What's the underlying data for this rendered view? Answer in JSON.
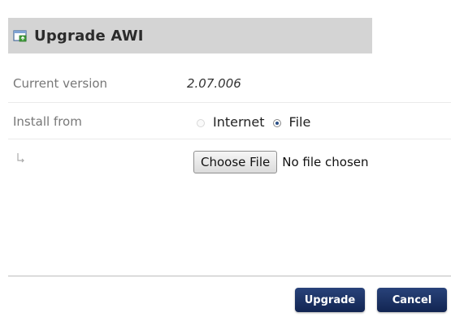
{
  "dialog": {
    "title": "Upgrade AWI",
    "title_icon": "upgrade-window-icon"
  },
  "rows": {
    "current_version": {
      "label": "Current version",
      "value": "2.07.006"
    },
    "install_from": {
      "label": "Install from",
      "options": [
        {
          "label": "Internet",
          "selected": false
        },
        {
          "label": "File",
          "selected": true
        }
      ]
    },
    "file": {
      "indent_icon": "sub-item-arrow-icon",
      "choose_button_label": "Choose File",
      "status": "No file chosen"
    }
  },
  "footer": {
    "upgrade_label": "Upgrade",
    "cancel_label": "Cancel"
  },
  "colors": {
    "header_bg": "#d4d4d4",
    "button_bg": "#1b3266",
    "label_gray": "#777777"
  }
}
